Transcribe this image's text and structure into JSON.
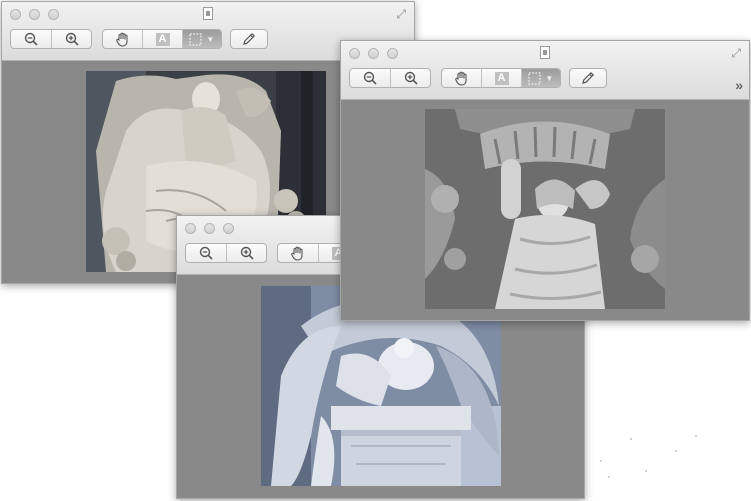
{
  "windows": [
    {
      "id": "sleeping-beauty-window",
      "toolbar": {
        "zoom_out": "zoom-out-icon",
        "zoom_in": "zoom-in-icon",
        "pan": "hand-icon",
        "text_select": "A",
        "rect_select": "rectangle-selection-icon",
        "markup": "pencil-icon"
      },
      "image_subject": "seated marble statue of a sleeping woman on a carved throne",
      "image_tone": "grey"
    },
    {
      "id": "caryatid-window",
      "toolbar": {
        "zoom_out": "zoom-out-icon",
        "zoom_in": "zoom-in-icon",
        "pan": "hand-icon",
        "text_select": "A",
        "rect_select": "rectangle-selection-icon",
        "markup": "pencil-icon"
      },
      "image_subject": "stone caryatid figure with raised arms beneath a scalloped canopy",
      "image_tone": "grey"
    },
    {
      "id": "angel-window",
      "toolbar": {
        "zoom_out": "zoom-out-icon",
        "zoom_in": "zoom-in-icon",
        "pan": "hand-icon",
        "text_select": "A"
      },
      "image_subject": "weeping angel statue with wings draped over a tomb",
      "image_tone": "blue-grey"
    }
  ],
  "colors": {
    "window_content": "#898989",
    "titlebar_top": "#f2f2f2",
    "titlebar_bottom": "#dcdcdc",
    "active_tool": "#a8a8a8"
  }
}
